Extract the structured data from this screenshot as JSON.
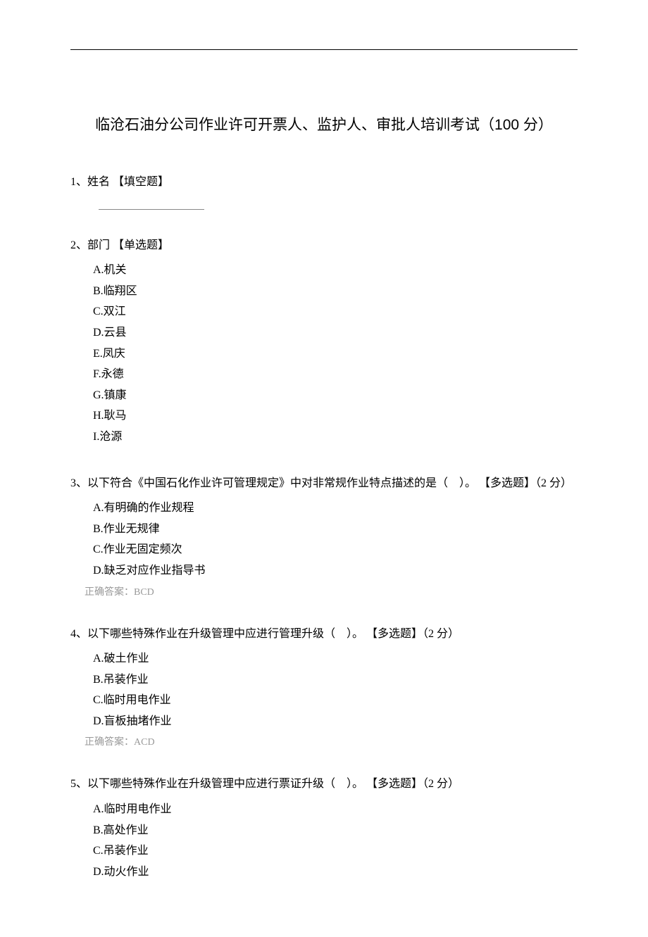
{
  "title": "临沧石油分公司作业许可开票人、监护人、审批人培训考试（100 分）",
  "questions": [
    {
      "num": "1、",
      "text": "姓名",
      "type": "【填空题】",
      "score": "",
      "options": [],
      "answer": "",
      "hasBlank": true
    },
    {
      "num": "2、",
      "text": "部门",
      "type": "【单选题】",
      "score": "",
      "options": [
        "A.机关",
        "B.临翔区",
        "C.双江",
        "D.云县",
        "E.凤庆",
        "F.永德",
        "G.镇康",
        "H.耿马",
        "I.沧源"
      ],
      "answer": ""
    },
    {
      "num": "3、",
      "text": "以下符合《中国石化作业许可管理规定》中对非常规作业特点描述的是（　）。",
      "type": "【多选题】",
      "score": "（2 分）",
      "options": [
        "A.有明确的作业规程",
        "B.作业无规律",
        "C.作业无固定频次",
        "D.缺乏对应作业指导书"
      ],
      "answer": "正确答案：BCD"
    },
    {
      "num": "4、",
      "text": "以下哪些特殊作业在升级管理中应进行管理升级（　）。",
      "type": "【多选题】",
      "score": "（2 分）",
      "options": [
        "A.破土作业",
        "B.吊装作业",
        "C.临时用电作业",
        "D.盲板抽堵作业"
      ],
      "answer": "正确答案：ACD"
    },
    {
      "num": "5、",
      "text": "以下哪些特殊作业在升级管理中应进行票证升级（　）。",
      "type": "【多选题】",
      "score": "（2 分）",
      "options": [
        "A.临时用电作业",
        "B.高处作业",
        "C.吊装作业",
        "D.动火作业"
      ],
      "answer": ""
    }
  ]
}
